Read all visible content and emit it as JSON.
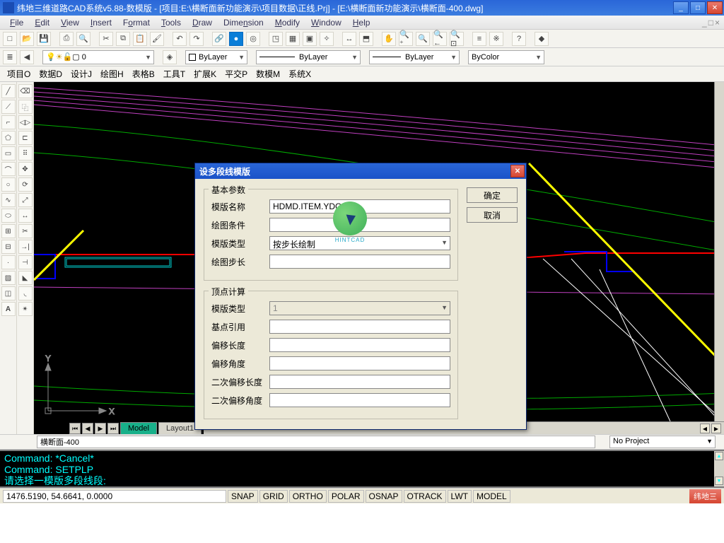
{
  "titlebar": {
    "text": "纬地三维道路CAD系统v5.88-数模版 - [项目:E:\\横断面新功能演示\\项目数据\\正线.Prj] - [E:\\横断面新功能演示\\横断面-400.dwg]"
  },
  "menu": {
    "file": "File",
    "edit": "Edit",
    "view": "View",
    "insert": "Insert",
    "format": "Format",
    "tools": "Tools",
    "draw": "Draw",
    "dimension": "Dimension",
    "modify": "Modify",
    "window": "Window",
    "help": "Help"
  },
  "toolbar2": {
    "layercombo": "0",
    "bylayer1": "ByLayer",
    "bylayer2": "ByLayer",
    "bylayer3": "ByLayer",
    "bycolor": "ByColor"
  },
  "menu2": {
    "items": [
      "项目O",
      "数据D",
      "设计J",
      "绘图H",
      "表格B",
      "工具T",
      "扩展K",
      "平交P",
      "数模M",
      "系统X"
    ]
  },
  "tabs": {
    "model": "Model",
    "layout": "Layout1"
  },
  "layerdrop": {
    "name": "横断面-400",
    "project": "No Project"
  },
  "dialog": {
    "title": "设多段线模版",
    "group1": "基本参数",
    "f_name": "模版名称",
    "f_name_v": "HDMD.ITEM.YDC.",
    "f_cond": "绘图条件",
    "f_type": "模版类型",
    "f_type_v": "按步长绘制",
    "f_step": "绘图步长",
    "group2": "顶点计算",
    "f_type2": "模版类型",
    "f_type2_v": "1",
    "f_base": "基点引用",
    "f_offlen": "偏移长度",
    "f_offang": "偏移角度",
    "f_off2len": "二次偏移长度",
    "f_off2ang": "二次偏移角度",
    "ok": "确定",
    "cancel": "取消"
  },
  "logo": "HINTCAD",
  "cmd": {
    "l1": "Command: *Cancel*",
    "l2": "Command: SETPLP",
    "l3": "请选择一模版多段线段:"
  },
  "status": {
    "coords": "1476.5190, 54.6641, 0.0000",
    "snap": "SNAP",
    "grid": "GRID",
    "ortho": "ORTHO",
    "polar": "POLAR",
    "osnap": "OSNAP",
    "otrack": "OTRACK",
    "lwt": "LWT",
    "model": "MODEL",
    "brand": "纬地三"
  }
}
